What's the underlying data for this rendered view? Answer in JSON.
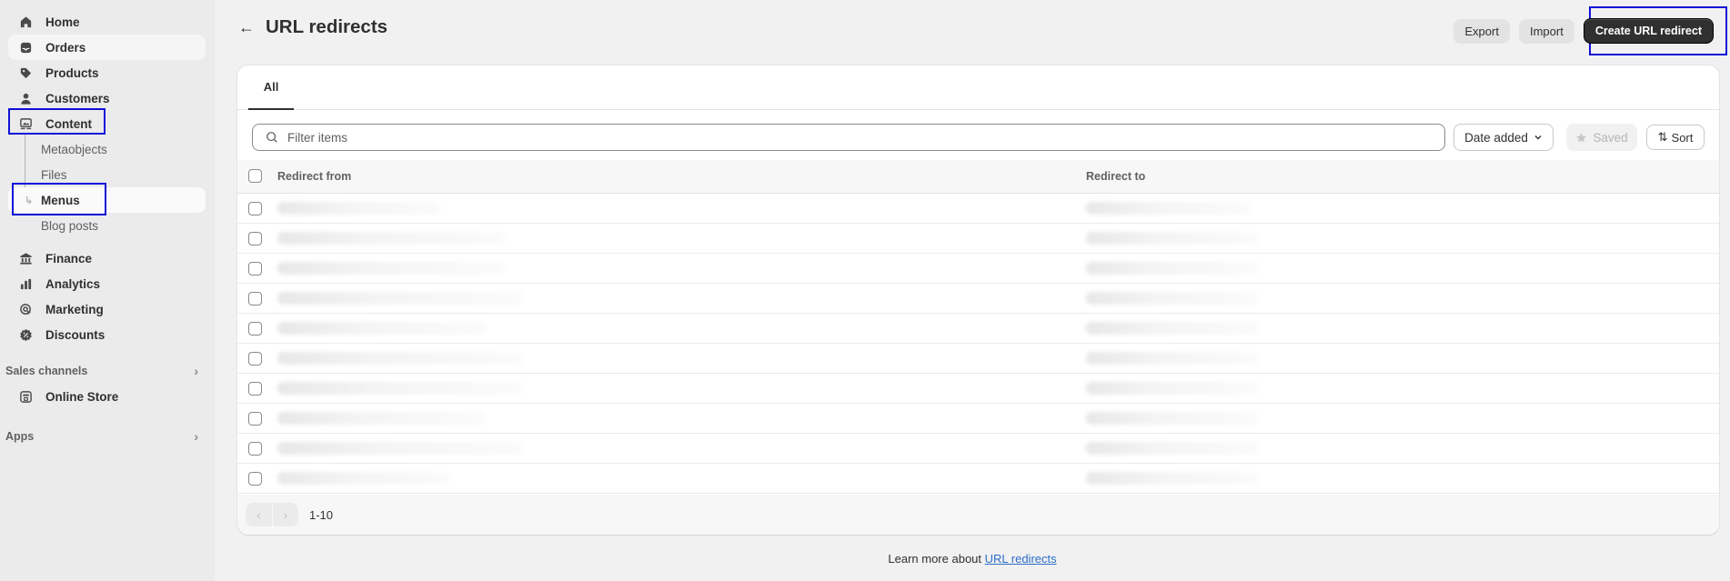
{
  "sidebar": {
    "items": [
      {
        "label": "Home",
        "icon": "home-icon"
      },
      {
        "label": "Orders",
        "icon": "inbox-icon"
      },
      {
        "label": "Products",
        "icon": "tag-icon"
      },
      {
        "label": "Customers",
        "icon": "person-icon"
      },
      {
        "label": "Content",
        "icon": "image-content-icon"
      }
    ],
    "content_sub": [
      {
        "label": "Metaobjects"
      },
      {
        "label": "Files"
      },
      {
        "label": "Menus"
      },
      {
        "label": "Blog posts"
      }
    ],
    "items2": [
      {
        "label": "Finance",
        "icon": "bank-icon"
      },
      {
        "label": "Analytics",
        "icon": "bar-chart-icon"
      },
      {
        "label": "Marketing",
        "icon": "target-icon"
      },
      {
        "label": "Discounts",
        "icon": "discount-icon"
      }
    ],
    "sales_channels": {
      "label": "Sales channels",
      "items": [
        {
          "label": "Online Store",
          "icon": "store-icon"
        }
      ]
    },
    "apps": {
      "label": "Apps"
    }
  },
  "header": {
    "back_icon": "arrow-left-icon",
    "title": "URL redirects",
    "export_label": "Export",
    "import_label": "Import",
    "create_label": "Create URL redirect"
  },
  "tabs": [
    {
      "label": "All",
      "selected": true
    }
  ],
  "toolbar": {
    "search_placeholder": "Filter items",
    "date_label": "Date added",
    "saved_label": "Saved",
    "sort_label": "Sort"
  },
  "table": {
    "columns": [
      "Redirect from",
      "Redirect to"
    ],
    "rows_note": "row contents blurred/redacted",
    "row_count": 10
  },
  "pagination": {
    "label": "1-10",
    "prev_enabled": false,
    "next_enabled": false
  },
  "footer": {
    "text": "Learn more about ",
    "link": "URL redirects"
  },
  "colors": {
    "primary_button": "#303030",
    "link": "#2c6ecb",
    "highlight_box": "#1010d8"
  }
}
